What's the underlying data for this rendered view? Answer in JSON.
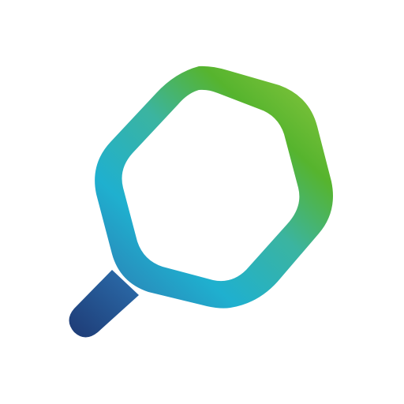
{
  "icon": {
    "name": "magnifier-hexagon-logo-icon",
    "colors": {
      "background": "#ffffff",
      "gradient_green": "#56b42e",
      "gradient_green_light": "#7cc23a",
      "gradient_teal": "#3bb4a0",
      "gradient_cyan": "#1fb0cf",
      "gradient_blue": "#2a86b8",
      "handle_blue_dark": "#1f3f7a",
      "handle_blue_light": "#2a6aa8"
    }
  }
}
